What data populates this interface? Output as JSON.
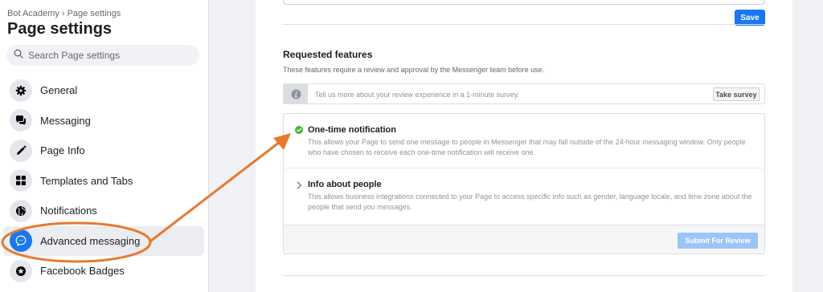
{
  "sidebar": {
    "breadcrumb": "Bot Academy › Page settings",
    "title": "Page settings",
    "search_placeholder": "Search Page settings",
    "items": [
      {
        "label": "General",
        "icon": "gear-icon"
      },
      {
        "label": "Messaging",
        "icon": "chat-bubbles-icon"
      },
      {
        "label": "Page Info",
        "icon": "pencil-icon"
      },
      {
        "label": "Templates and Tabs",
        "icon": "grid-icon"
      },
      {
        "label": "Notifications",
        "icon": "globe-icon"
      },
      {
        "label": "Advanced messaging",
        "icon": "messenger-icon",
        "active": true
      },
      {
        "label": "Facebook Badges",
        "icon": "badge-star-icon"
      }
    ]
  },
  "main": {
    "save_label": "Save",
    "requested_features": {
      "title": "Requested features",
      "subtitle": "These features require a review and approval by the Messenger team before use.",
      "survey": {
        "text": "Tell us more about your review experience in a 1-minute survey.",
        "button": "Take survey"
      },
      "features": [
        {
          "title": "One-time notification",
          "description": "This allows your Page to send one message to people in Messenger that may fall outside of the 24-hour messaging window. Only people who have chosen to receive each one-time notification will receive one.",
          "status_icon": "check-circle-icon"
        },
        {
          "title": "Info about people",
          "description": "This allows business integrations connected to your Page to access specific info such as gender, language locale, and time zone about the people that send you messages.",
          "status_icon": "chevron-right-icon"
        }
      ],
      "submit_label": "Submit For Review"
    }
  },
  "annotation": {
    "color": "#e8792f"
  },
  "colors": {
    "accent": "#1877f2",
    "success": "#42b72a"
  }
}
